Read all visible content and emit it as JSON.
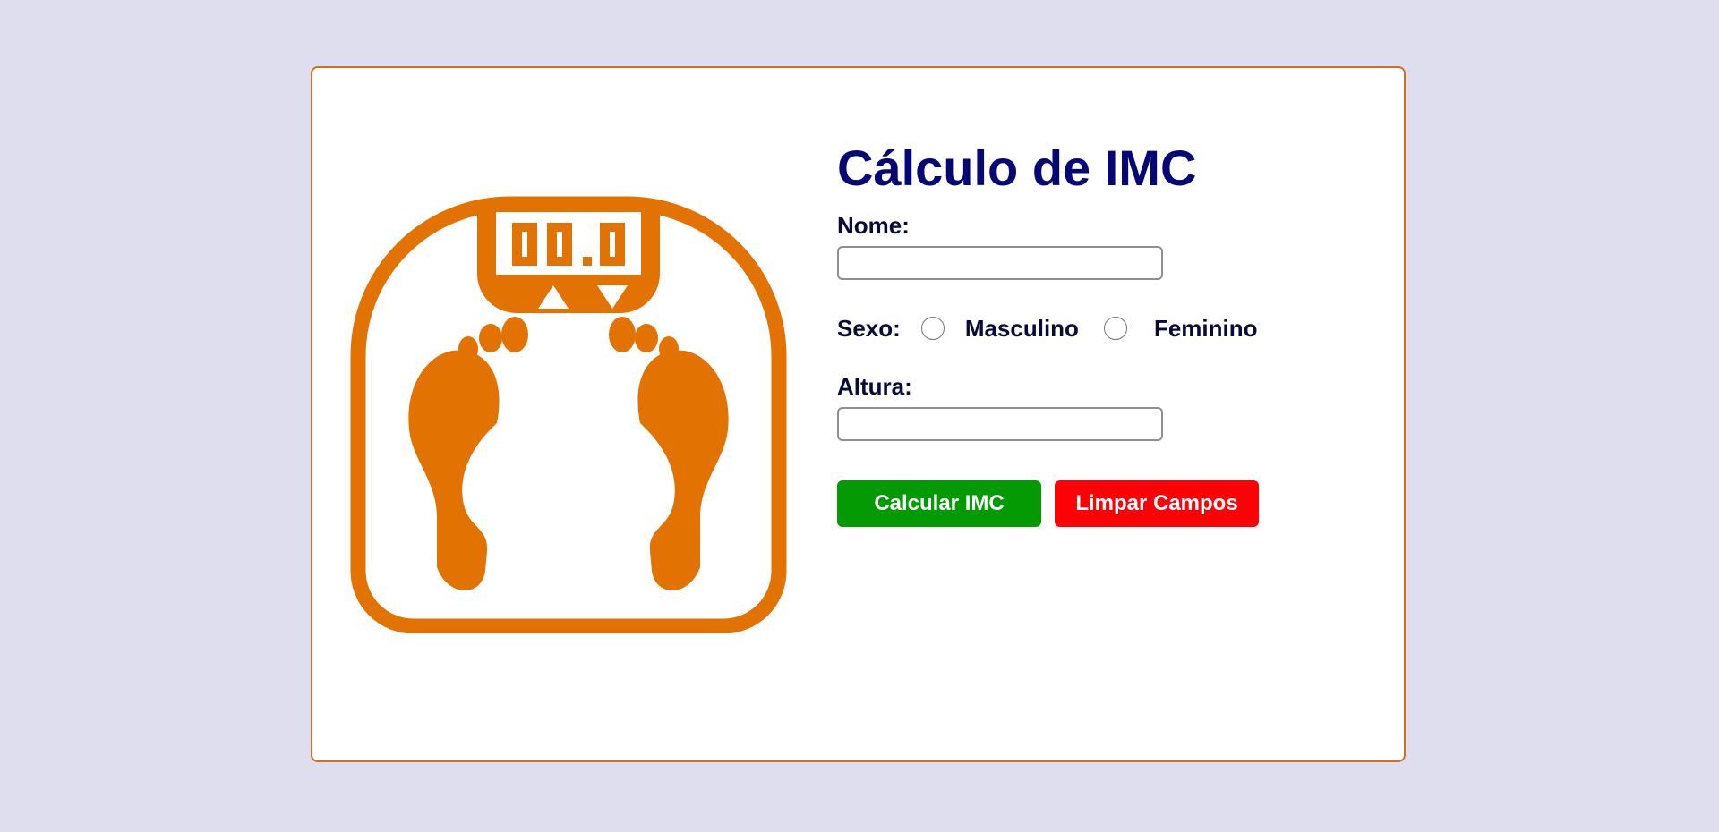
{
  "colors": {
    "page_background": "#dfdeee",
    "card_border": "#cf6f22",
    "illustration": "#e27302",
    "title": "#070676",
    "calc_button": "#049a04",
    "clear_button": "#fd0106"
  },
  "illustration": {
    "icon": "bathroom-scale-with-footprints",
    "display_text": "00.0"
  },
  "form": {
    "title": "Cálculo de IMC",
    "nome_label": "Nome:",
    "nome_value": "",
    "sexo_label": "Sexo:",
    "sexo_options": [
      "Masculino",
      "Feminino"
    ],
    "altura_label": "Altura:",
    "altura_value": ""
  },
  "buttons": {
    "calc_label": "Calcular IMC",
    "clear_label": "Limpar Campos"
  }
}
